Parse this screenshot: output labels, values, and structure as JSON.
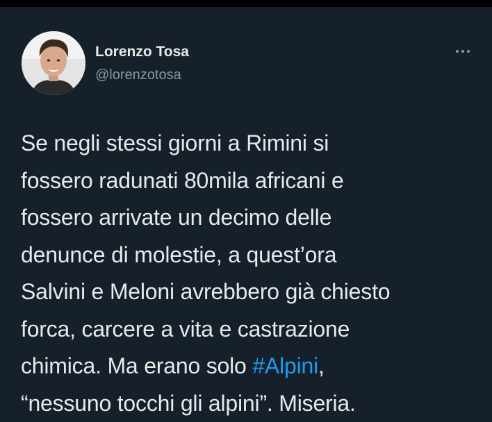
{
  "author": {
    "name": "Lorenzo Tosa",
    "handle": "@lorenzotosa"
  },
  "more_menu_icon": "more-horizontal-icon",
  "tweet": {
    "lines": [
      "Se negli stessi giorni a Rimini si",
      "fossero radunati 80mila africani e",
      "fossero arrivate un decimo delle",
      "denunce di molestie, a quest’ora",
      "Salvini e Meloni avrebbero già chiesto",
      "forca, carcere a vita e castrazione"
    ],
    "line7_prefix": "chimica. Ma erano solo ",
    "hashtag": "#Alpini",
    "line7_suffix": ",",
    "line8": "“nessuno tocchi gli alpini”. Miseria."
  },
  "colors": {
    "background": "#15202b",
    "text": "#e7e9ea",
    "secondary_text": "#8b98a5",
    "hashtag": "#1d9bf0"
  }
}
